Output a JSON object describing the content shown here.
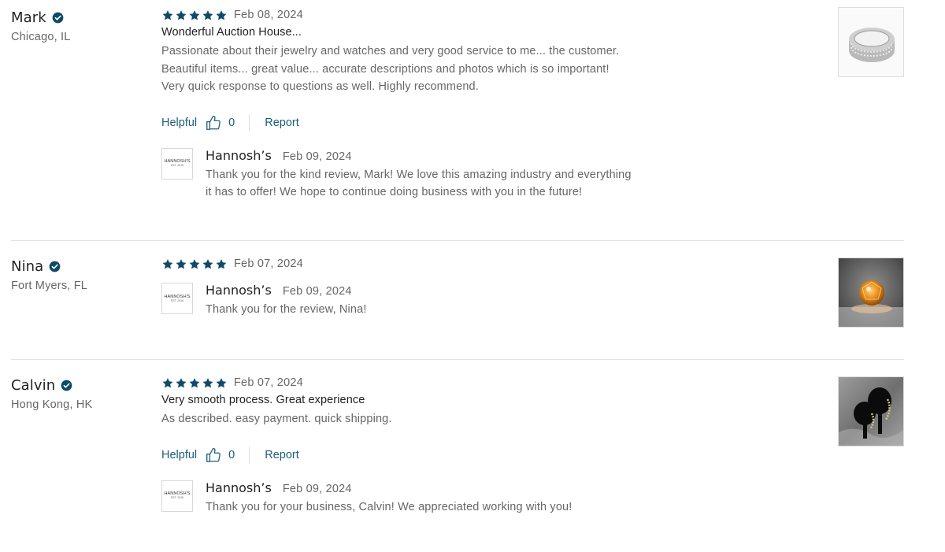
{
  "colors": {
    "accent": "#1a5e7a",
    "star": "#0f4a68",
    "verified": "#0f4a68",
    "muted_text": "#666666"
  },
  "reviews": [
    {
      "reviewer": {
        "name": "Mark",
        "location": "Chicago, IL",
        "verified": true
      },
      "rating": 5,
      "date": "Feb 08, 2024",
      "title": "Wonderful Auction House...",
      "text_lines": [
        "Passionate about their jewelry and watches and very good service to me... the customer.",
        "Beautiful items... great value... accurate descriptions and photos which is so important!",
        "Very quick response to questions as well. Highly recommend."
      ],
      "helpful": {
        "label": "Helpful",
        "count": "0"
      },
      "report_label": "Report",
      "reply": {
        "logo_text": "HANNOSH'S",
        "logo_sub": "EST. 2016",
        "name": "Hannosh’s",
        "date": "Feb 09, 2024",
        "text_lines": [
          "Thank you for the kind review, Mark! We love this amazing industry and everything",
          "it has to offer! We hope to continue doing business with you in the future!"
        ]
      },
      "thumbnail_icon": "ring-photo"
    },
    {
      "reviewer": {
        "name": "Nina",
        "location": "Fort Myers, FL",
        "verified": true
      },
      "rating": 5,
      "date": "Feb 07, 2024",
      "reply": {
        "logo_text": "HANNOSH'S",
        "logo_sub": "EST. 2016",
        "name": "Hannosh’s",
        "date": "Feb 09, 2024",
        "text_lines": [
          "Thank you for the review, Nina!"
        ]
      },
      "thumbnail_icon": "orange-gemstone-photo"
    },
    {
      "reviewer": {
        "name": "Calvin",
        "location": "Hong Kong, HK",
        "verified": true
      },
      "rating": 5,
      "date": "Feb 07, 2024",
      "title": "Very smooth process. Great experience",
      "text_lines": [
        "As described. easy payment. quick shipping."
      ],
      "helpful": {
        "label": "Helpful",
        "count": "0"
      },
      "report_label": "Report",
      "reply": {
        "logo_text": "HANNOSH'S",
        "logo_sub": "EST. 2016",
        "name": "Hannosh’s",
        "date": "Feb 09, 2024",
        "text_lines": [
          "Thank you for your business, Calvin! We appreciated working with you!"
        ]
      },
      "thumbnail_icon": "black-earrings-photo"
    }
  ]
}
